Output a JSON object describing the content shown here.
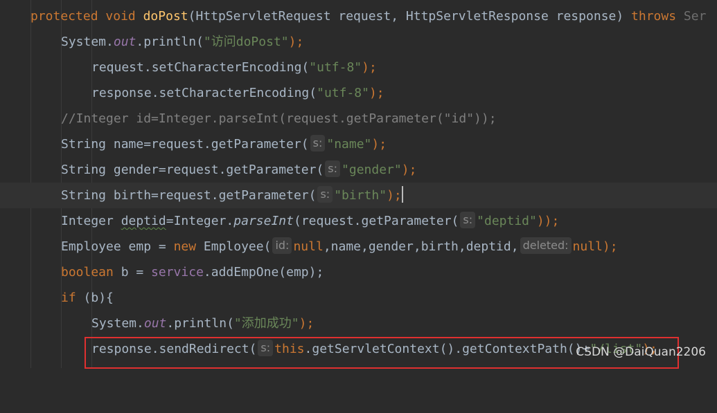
{
  "lines": [
    [
      "protected",
      "void",
      "doPost",
      "(HttpServletRequest request, HttpServletResponse response) ",
      "throws",
      "Ser"
    ],
    [
      "System.",
      "out",
      ".println(",
      "\"访问doPost\"",
      ");"
    ],
    [
      "request.setCharacterEncoding(",
      "\"utf-8\"",
      ");"
    ],
    [
      "response.setCharacterEncoding(",
      "\"utf-8\"",
      ");"
    ],
    [
      "//Integer id=Integer.parseInt(request.getParameter(\"id\"));"
    ],
    [
      "String name=request.getParameter(",
      "s:",
      "\"name\"",
      ");"
    ],
    [
      "String gender=request.getParameter(",
      "s:",
      "\"gender\"",
      ");"
    ],
    [
      "String birth=request.getParameter(",
      "s:",
      "\"birth\"",
      ");"
    ],
    [
      "Integer ",
      "deptid",
      "=Integer.",
      "parseInt",
      "(request.getParameter(",
      "s:",
      "\"deptid\"",
      "));"
    ],
    [
      "Employee emp = ",
      "new",
      " Employee(",
      "id:",
      "null",
      ",name,gender,birth,deptid,",
      "deleted:",
      "null",
      ");"
    ],
    [
      "boolean",
      " b = ",
      "service",
      ".addEmpOne(emp);"
    ],
    [
      "if",
      " (b){"
    ],
    [
      "System.",
      "out",
      ".println(",
      "\"添加成功\"",
      ");"
    ],
    [
      "response.sendRedirect(",
      "s:",
      "this",
      ".getServletContext().getContextPath()+",
      "\"/list\"",
      ");"
    ]
  ],
  "watermark": "CSDN @DaiQuan2206"
}
